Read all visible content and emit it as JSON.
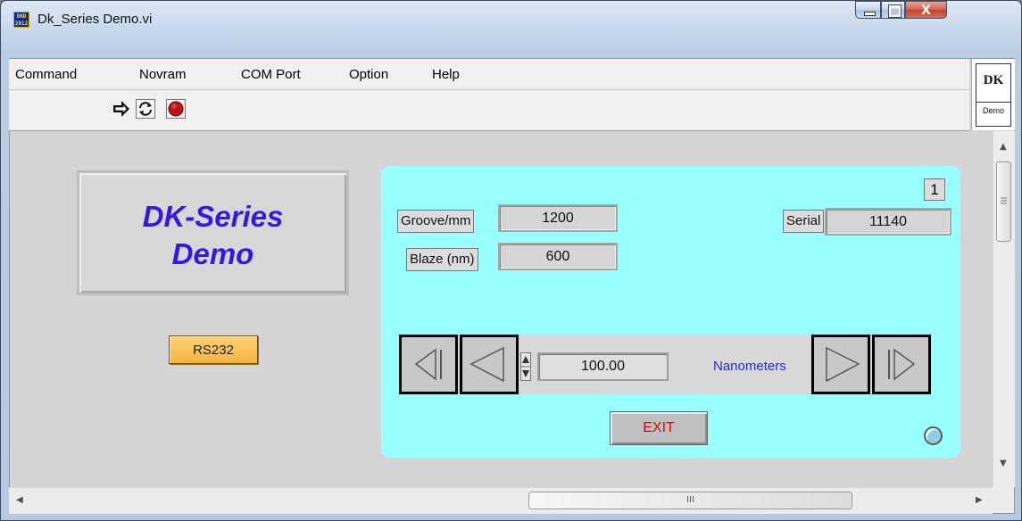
{
  "window": {
    "title": "Dk_Series Demo.vi",
    "icon_text": "DKD\n2012",
    "controls": [
      "minimize-icon",
      "maximize-icon",
      "close-icon"
    ],
    "close_glyph": "X"
  },
  "menu": {
    "items": [
      "Command",
      "Novram",
      "COM Port",
      "Option",
      "Help"
    ]
  },
  "toolbar": {
    "buttons": [
      "run-arrow-icon",
      "run-continuously-icon",
      "abort-stop-icon"
    ]
  },
  "logo": {
    "big": "DK",
    "small": "Demo"
  },
  "panel": {
    "title": "DK-Series\nDemo",
    "port_button": "RS232",
    "index_value": "1",
    "groove_label": "Groove/mm",
    "groove_value": "1200",
    "blaze_label": "Blaze (nm)",
    "blaze_value": "600",
    "serial_label": "Serial",
    "serial_value": "11140",
    "wavelength_value": "100.00",
    "units_label": "Nanometers",
    "exit_label": "EXIT",
    "colors": {
      "title": "#3a16e6",
      "cyan_panel": "#99ffff",
      "rs_button": "#f5b43e",
      "exit_text": "#e40000",
      "units_text": "#2a25e6"
    }
  },
  "scrollbar": {
    "h_grip_glyph": "III"
  }
}
